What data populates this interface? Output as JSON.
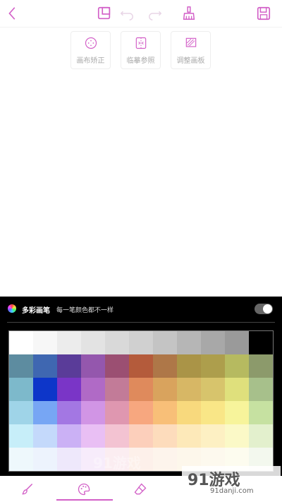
{
  "toolbar": {
    "back": "chevron-left-icon",
    "layers": "layers-icon",
    "undo": "undo-icon",
    "redo": "redo-icon",
    "clear": "broom-icon",
    "save": "save-icon"
  },
  "canvas_tools": [
    {
      "label": "画布矫正",
      "icon": "dots-circle-icon"
    },
    {
      "label": "临摹参照",
      "icon": "reference-icon"
    },
    {
      "label": "调整画板",
      "icon": "adjust-board-icon"
    }
  ],
  "palette": {
    "title": "多彩画笔",
    "subtitle": "每一笔颜色都不一样",
    "toggle_on": true,
    "colors": [
      [
        "#ffffff",
        "#f7f7f7",
        "#ececec",
        "#e3e3e3",
        "#d9d9d9",
        "#d0d0d0",
        "#c4c4c4",
        "#b6b6b6",
        "#a8a8a8",
        "#9a9a9a",
        "#000000"
      ],
      [
        "#5d8ca0",
        "#3f67b1",
        "#5a3c99",
        "#9457ad",
        "#9b4f72",
        "#b45b3b",
        "#ae7748",
        "#aa9447",
        "#ad9e4c",
        "#b6ba60",
        "#8c9a6b"
      ],
      [
        "#7db9cb",
        "#0d36c9",
        "#7a35c7",
        "#b06ac6",
        "#c27b98",
        "#df8a5c",
        "#d9a35d",
        "#d7b765",
        "#d7c46c",
        "#dfe07c",
        "#a7c08b"
      ],
      [
        "#9fd4e8",
        "#77a6f4",
        "#a377e3",
        "#d195e5",
        "#df97b0",
        "#f7a77f",
        "#f8bf78",
        "#f8d97d",
        "#f9e687",
        "#f7f49b",
        "#c6e1a1"
      ],
      [
        "#c7eef9",
        "#c4d9fb",
        "#cbb1f5",
        "#e9bff4",
        "#f3c3d2",
        "#fccfbb",
        "#fddcbc",
        "#fde9b9",
        "#fdf0c3",
        "#fbf9c7",
        "#e3f0cd"
      ],
      [
        "#eef8fc",
        "#edf3fd",
        "#eee8fb",
        "#f7ecfb",
        "#fbedf1",
        "#fdf0ea",
        "#fdf4ec",
        "#fdf7eb",
        "#fdf9ee",
        "#fdfcef",
        "#f3f8ee"
      ]
    ]
  },
  "bottom_tabs": [
    {
      "icon": "brush-icon",
      "active": false
    },
    {
      "icon": "palette-icon",
      "active": true
    },
    {
      "icon": "eraser-icon",
      "active": false
    }
  ],
  "accent_color": "#d25fc7",
  "watermark": {
    "brand": "91游戏",
    "url": "91danji.com",
    "faint": "91游戏"
  }
}
